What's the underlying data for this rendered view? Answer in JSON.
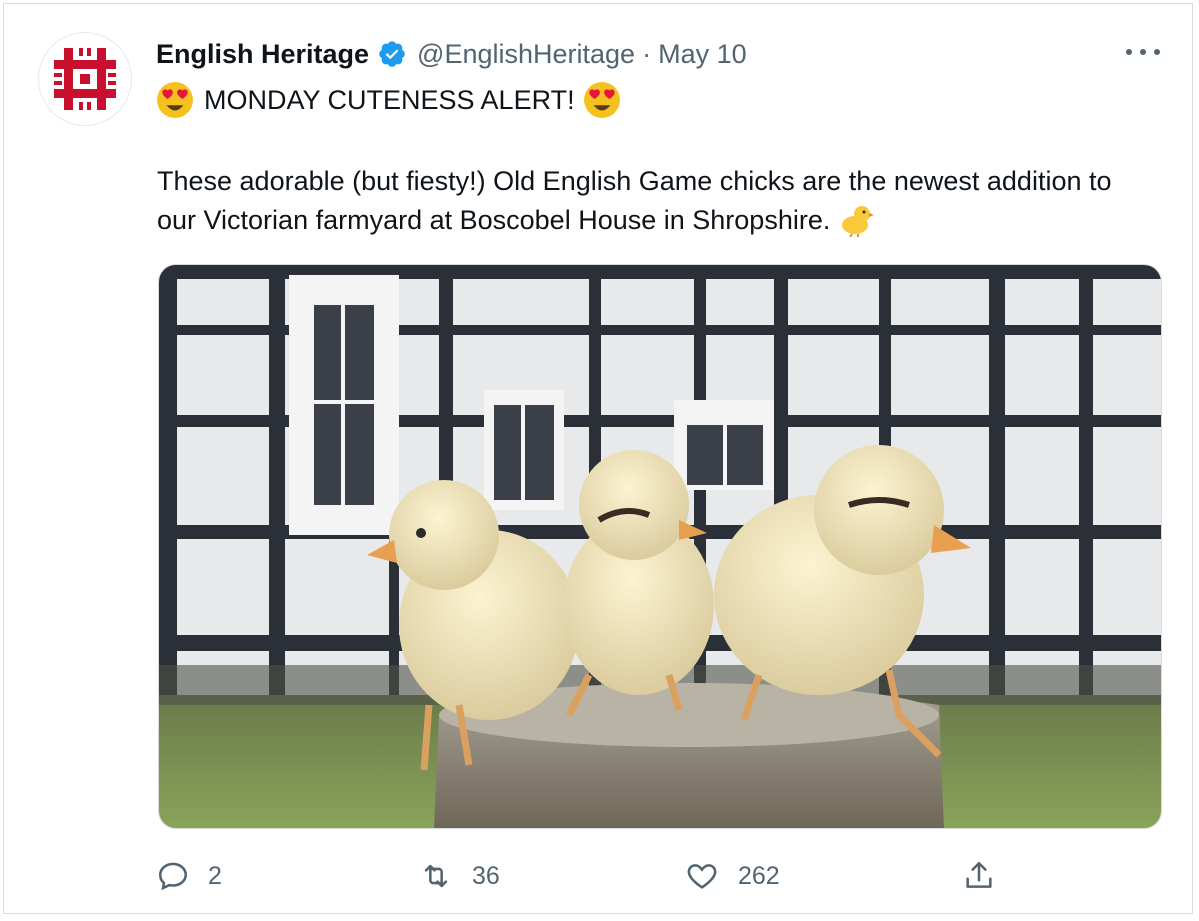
{
  "tweet": {
    "author_name": "English Heritage",
    "handle": "@EnglishHeritage",
    "separator": "·",
    "date": "May 10",
    "line1": "MONDAY CUTENESS ALERT!",
    "body": "These adorable (but fiesty!) Old English Game chicks are the newest addition to our Victorian farmyard at Boscobel House in Shropshire.",
    "emojis": [
      "smiling-face-with-heart-eyes",
      "baby-chick"
    ]
  },
  "icons": {
    "avatar": "english-heritage-logo",
    "verified": "verified-badge-icon",
    "more": "more-options-icon",
    "reply": "reply-icon",
    "retweet": "retweet-icon",
    "like": "heart-icon",
    "share": "share-icon"
  },
  "actions": {
    "reply_count": "2",
    "retweet_count": "36",
    "like_count": "262"
  },
  "colors": {
    "brand_red": "#c8102e",
    "verified_blue": "#1d9bf0",
    "secondary_text": "#536471"
  }
}
